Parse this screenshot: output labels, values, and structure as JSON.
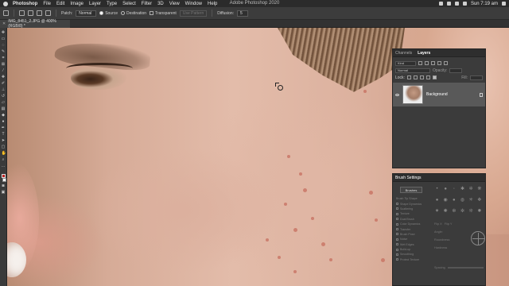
{
  "menubar": {
    "app": "Photoshop",
    "items": [
      "File",
      "Edit",
      "Image",
      "Layer",
      "Type",
      "Select",
      "Filter",
      "3D",
      "View",
      "Window",
      "Help"
    ],
    "window_title": "Adobe Photoshop 2020",
    "clock": "Sun 7:19 am"
  },
  "options": {
    "patch_label": "Patch:",
    "patch_mode": "Normal",
    "source": "Source",
    "destination": "Destination",
    "transparent": "Transparent",
    "use_pattern": "Use Pattern",
    "diffusion_label": "Diffusion:",
    "diffusion_value": "5"
  },
  "document": {
    "tab": "IMG_8451_2.JPG @ 400% (RGB/8) *"
  },
  "layers_panel": {
    "tabs": [
      "Channels",
      "Layers"
    ],
    "active_tab": "Layers",
    "kind": "Kind",
    "blend_mode": "Normal",
    "opacity_label": "Opacity:",
    "lock_label": "Lock:",
    "fill_label": "Fill:",
    "layer_name": "Background"
  },
  "brush_panel": {
    "title": "Brush Settings",
    "brushes_button": "Brushes",
    "options": [
      "Brush Tip Shape",
      "Shape Dynamics",
      "Scattering",
      "Texture",
      "Dual Brush",
      "Color Dynamics",
      "Transfer",
      "Brush Pose",
      "Noise",
      "Wet Edges",
      "Build-up",
      "Smoothing",
      "Protect Texture"
    ],
    "flip_x": "Flip X",
    "flip_y": "Flip Y",
    "angle": "Angle:",
    "roundness": "Roundness:",
    "hardness": "Hardness",
    "spacing": "Spacing"
  }
}
